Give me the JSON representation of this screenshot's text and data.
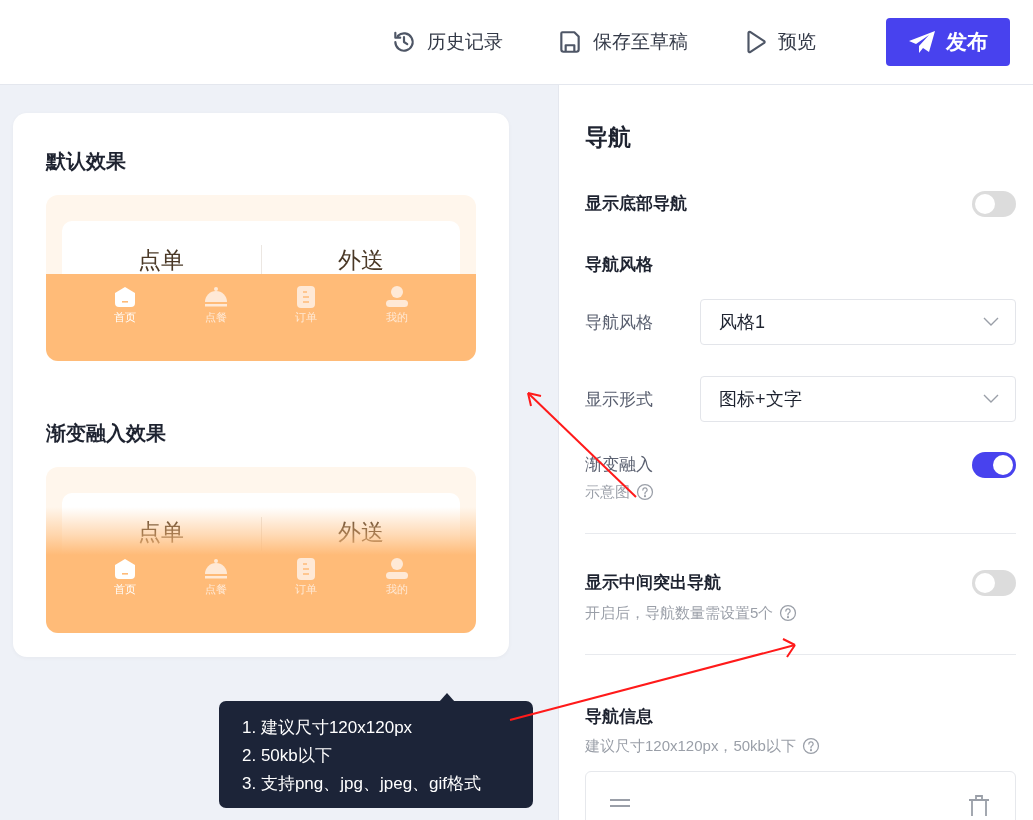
{
  "header": {
    "actions": [
      {
        "label": "历史记录",
        "kind": "history"
      },
      {
        "label": "保存至草稿",
        "kind": "save"
      },
      {
        "label": "预览",
        "kind": "preview"
      }
    ],
    "publish": "发布"
  },
  "preview": {
    "sections": [
      {
        "title": "默认效果",
        "fade": false,
        "tabs": [
          "点单",
          "外送"
        ],
        "nav_items": [
          {
            "label": "首页",
            "kind": "home",
            "selected": true
          },
          {
            "label": "点餐",
            "kind": "cloche",
            "selected": false
          },
          {
            "label": "订单",
            "kind": "order",
            "selected": false
          },
          {
            "label": "我的",
            "kind": "user",
            "selected": false
          }
        ]
      },
      {
        "title": "渐变融入效果",
        "fade": true,
        "tabs": [
          "点单",
          "外送"
        ],
        "nav_items": [
          {
            "label": "首页",
            "kind": "home",
            "selected": true
          },
          {
            "label": "点餐",
            "kind": "cloche",
            "selected": false
          },
          {
            "label": "订单",
            "kind": "order",
            "selected": false
          },
          {
            "label": "我的",
            "kind": "user",
            "selected": false
          }
        ]
      }
    ]
  },
  "tooltip": {
    "lines": [
      "1. 建议尺寸120x120px",
      "2. 50kb以下",
      "3. 支持png、jpg、jpeg、gif格式"
    ]
  },
  "panel": {
    "title": "导航",
    "bottom_nav": {
      "label": "显示底部导航",
      "on": false
    },
    "style_heading": "导航风格",
    "selects": [
      {
        "label": "导航风格",
        "value": "风格1"
      },
      {
        "label": "显示形式",
        "value": "图标+文字"
      }
    ],
    "fade": {
      "label": "渐变融入",
      "hint": "示意图",
      "on": true
    },
    "center_nav": {
      "label": "显示中间突出导航",
      "hint": "开启后，导航数量需设置5个",
      "on": false
    },
    "info": {
      "title": "导航信息",
      "hint": "建议尺寸120x120px，50kb以下"
    }
  }
}
